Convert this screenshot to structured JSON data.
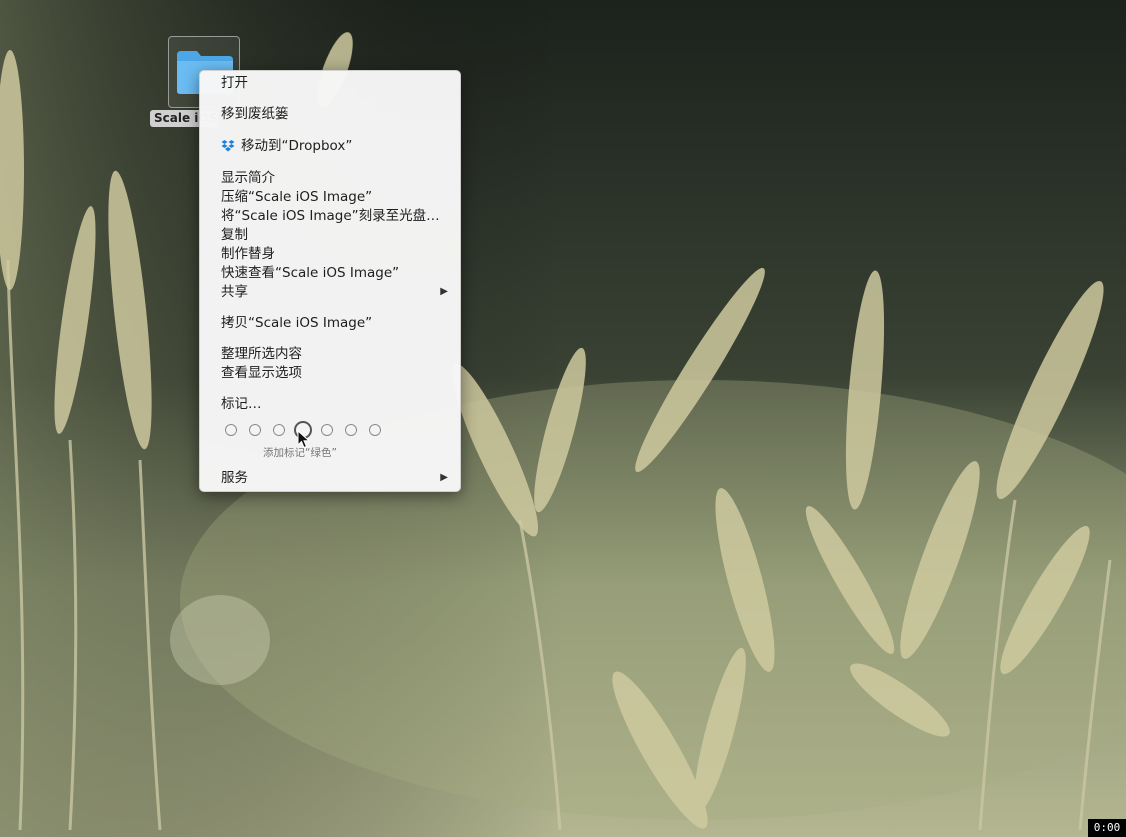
{
  "desktop": {
    "folder_label": "Scale iOS Image"
  },
  "menu": {
    "open": "打开",
    "trash": "移到废纸篓",
    "dropbox": "移动到“Dropbox”",
    "get_info": "显示简介",
    "compress": "压缩“Scale iOS Image”",
    "burn": "将“Scale iOS Image”刻录至光盘…",
    "duplicate": "复制",
    "make_alias": "制作替身",
    "quick_look": "快速查看“Scale iOS Image”",
    "share": "共享",
    "copy": "拷贝“Scale iOS Image”",
    "clean_up": "整理所选内容",
    "view_options": "查看显示选项",
    "tags": "标记…",
    "tag_hint": "添加标记“绿色”",
    "services": "服务"
  },
  "recording_timer": "0:00",
  "colors": {
    "menu_bg": "#f6f6f6",
    "folder_blue": "#62b8f0"
  }
}
